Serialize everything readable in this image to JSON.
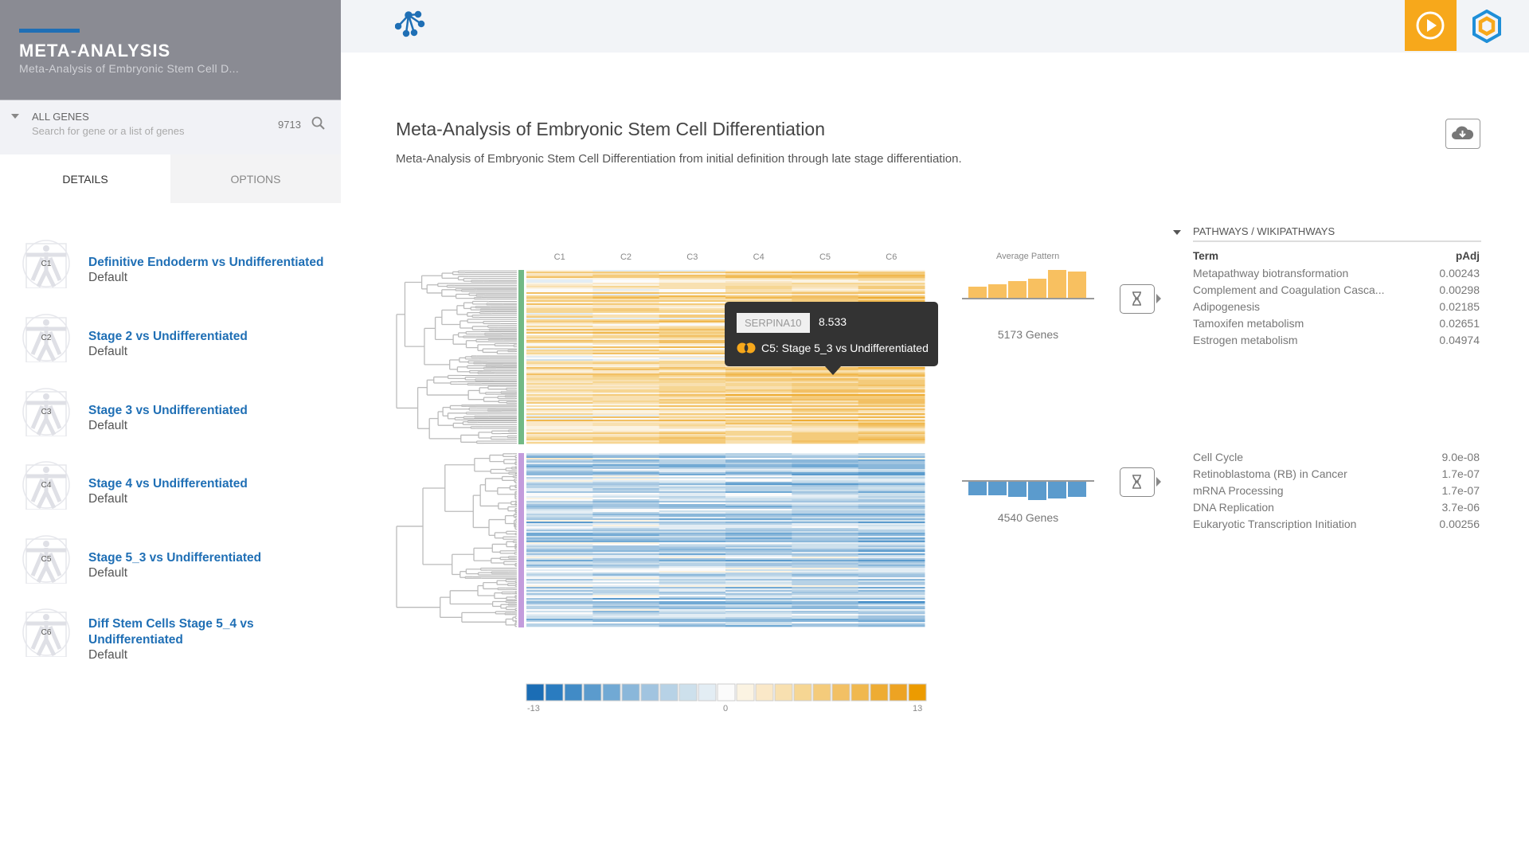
{
  "sidebar": {
    "title": "META-ANALYSIS",
    "subtitle": "Meta-Analysis of Embryonic Stem Cell D...",
    "accent": "#1f6fb5",
    "search": {
      "label": "ALL GENES",
      "placeholder": "Search for gene or a list of genes",
      "count": "9713"
    },
    "tabs": [
      {
        "label": "DETAILS",
        "active": true
      },
      {
        "label": "OPTIONS",
        "active": false
      }
    ],
    "comparisons": [
      {
        "code": "C1",
        "title": "Definitive Endoderm vs Undifferentiated",
        "sub": "Default"
      },
      {
        "code": "C2",
        "title": "Stage 2 vs Undifferentiated",
        "sub": "Default"
      },
      {
        "code": "C3",
        "title": "Stage 3 vs Undifferentiated",
        "sub": "Default"
      },
      {
        "code": "C4",
        "title": "Stage 4 vs Undifferentiated",
        "sub": "Default"
      },
      {
        "code": "C5",
        "title": "Stage 5_3 vs Undifferentiated",
        "sub": "Default"
      },
      {
        "code": "C6",
        "title": "Diff Stem Cells Stage 5_4 vs Undifferentiated",
        "sub": "Default"
      }
    ]
  },
  "topbar": {
    "logo": "network-logo-icon",
    "play": "play-circle-icon",
    "brand": "hexagon-brand-icon",
    "play_color": "#f7a81b"
  },
  "main": {
    "title": "Meta-Analysis of Embryonic Stem Cell Differentiation",
    "description": "Meta-Analysis of Embryonic Stem Cell Differentiation from initial definition through late stage differentiation.",
    "download_icon": "cloud-download-icon"
  },
  "heatmap": {
    "columns": [
      "C1",
      "C2",
      "C3",
      "C4",
      "C5",
      "C6"
    ],
    "tooltip": {
      "gene": "SERPINA10",
      "value": "8.533",
      "comparison": "C5: Stage 5_3 vs Undifferentiated"
    },
    "clusters": [
      {
        "color": "#72b985",
        "genes": "5173 Genes",
        "avg_pattern": [
          14,
          17,
          21,
          24,
          35,
          33
        ],
        "bar_color": "#f8c060",
        "pathways": [
          {
            "term": "Metapathway biotransformation",
            "padj": "0.00243"
          },
          {
            "term": "Complement and Coagulation Casca...",
            "padj": "0.00298"
          },
          {
            "term": "Adipogenesis",
            "padj": "0.02185"
          },
          {
            "term": "Tamoxifen metabolism",
            "padj": "0.02651"
          },
          {
            "term": "Estrogen metabolism",
            "padj": "0.04974"
          }
        ]
      },
      {
        "color": "#c39cdc",
        "genes": "4540 Genes",
        "avg_pattern": [
          -17,
          -17,
          -19,
          -23,
          -21,
          -19
        ],
        "bar_color": "#5b9bcd",
        "pathways": [
          {
            "term": "Cell Cycle",
            "padj": "9.0e-08"
          },
          {
            "term": "Retinoblastoma (RB) in Cancer",
            "padj": "1.7e-07"
          },
          {
            "term": "mRNA Processing",
            "padj": "1.7e-07"
          },
          {
            "term": "DNA Replication",
            "padj": "3.7e-06"
          },
          {
            "term": "Eukaryotic Transcription Initiation",
            "padj": "0.00256"
          }
        ]
      }
    ],
    "avg_label": "Average Pattern",
    "pathways_header": "PATHWAYS / WIKIPATHWAYS",
    "pathways_cols": {
      "term": "Term",
      "padj": "pAdj"
    },
    "legend": {
      "min": "-13",
      "mid": "0",
      "max": "13",
      "colors": [
        "#1b6db5",
        "#2a7cc0",
        "#418bc6",
        "#5b9bcd",
        "#71a9d4",
        "#8ab7da",
        "#a1c4e0",
        "#b7d2e6",
        "#cde0ec",
        "#e3edf4",
        "#fbfbfb",
        "#fbf3e2",
        "#fae8c8",
        "#f8e0b0",
        "#f6d693",
        "#f4cb7b",
        "#f2c064",
        "#f0b84e",
        "#eeac33",
        "#eda323",
        "#ec9b00"
      ]
    }
  }
}
